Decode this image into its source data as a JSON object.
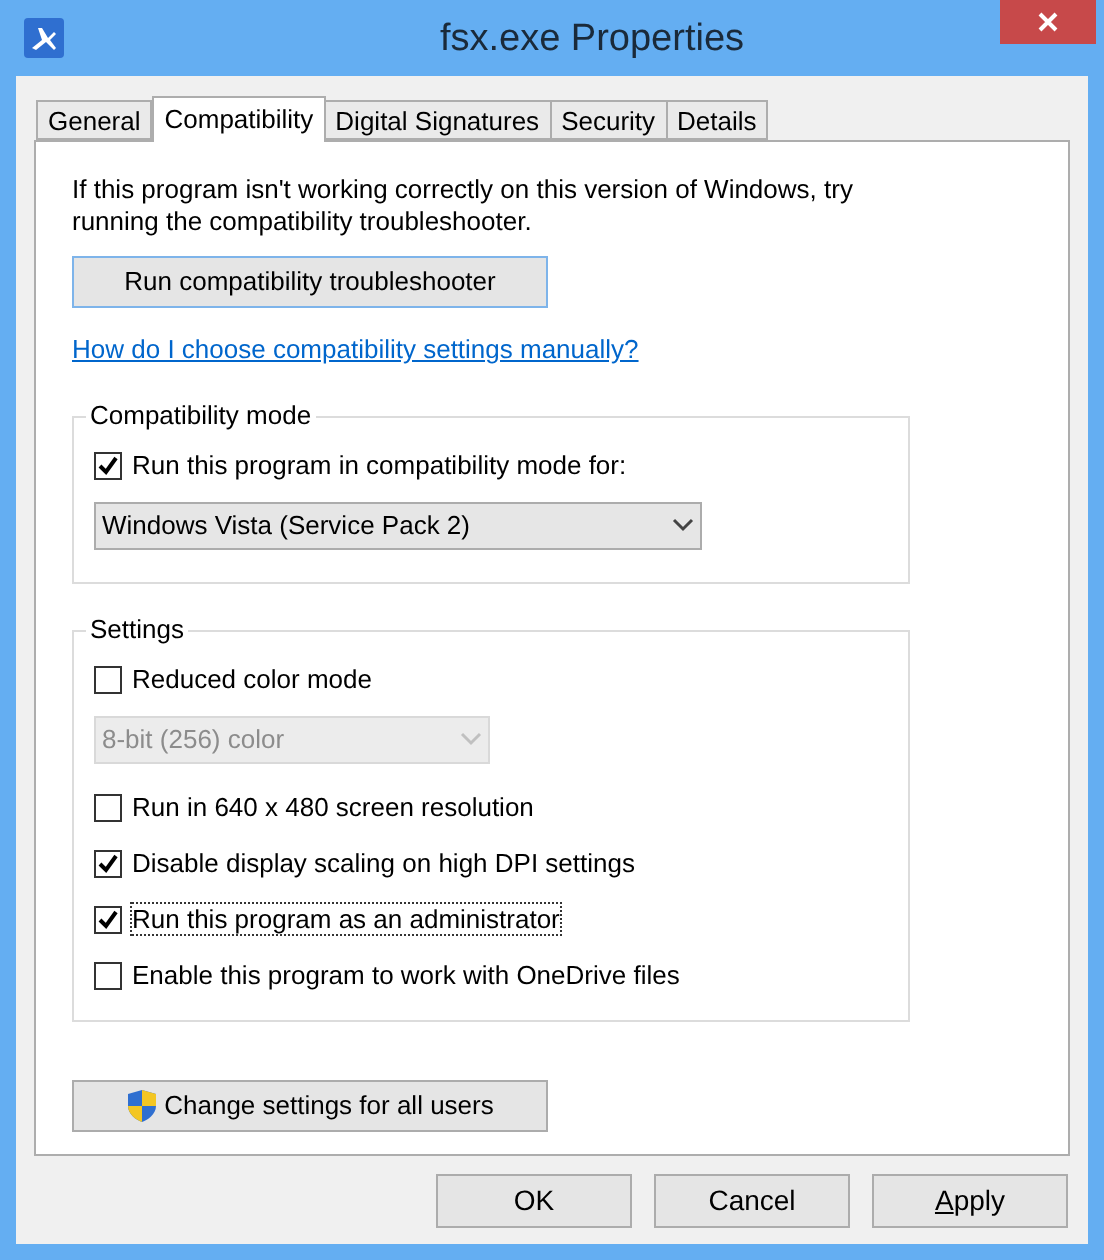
{
  "window": {
    "title": "fsx.exe Properties"
  },
  "tabs": [
    {
      "label": "General",
      "selected": false
    },
    {
      "label": "Compatibility",
      "selected": true
    },
    {
      "label": "Digital Signatures",
      "selected": false
    },
    {
      "label": "Security",
      "selected": false
    },
    {
      "label": "Details",
      "selected": false
    }
  ],
  "intro": "If this program isn't working correctly on this version of Windows, try running the compatibility troubleshooter.",
  "troubleshooter_button": "Run compatibility troubleshooter",
  "help_link": "How do I choose compatibility settings manually?",
  "compatibility_mode": {
    "title": "Compatibility mode",
    "checkbox": {
      "label": "Run this program in compatibility mode for:",
      "checked": true
    },
    "dropdown": {
      "value": "Windows Vista (Service Pack 2)",
      "disabled": false
    }
  },
  "settings": {
    "title": "Settings",
    "items": [
      {
        "kind": "checkbox",
        "label": "Reduced color mode",
        "checked": false,
        "focused": false
      },
      {
        "kind": "dropdown",
        "value": "8-bit (256) color",
        "disabled": true
      },
      {
        "kind": "checkbox",
        "label": "Run in 640 x 480 screen resolution",
        "checked": false,
        "focused": false
      },
      {
        "kind": "checkbox",
        "label": "Disable display scaling on high DPI settings",
        "checked": true,
        "focused": false
      },
      {
        "kind": "checkbox",
        "label": "Run this program as an administrator",
        "checked": true,
        "focused": true
      },
      {
        "kind": "checkbox",
        "label": "Enable this program to work with OneDrive files",
        "checked": false,
        "focused": false
      }
    ]
  },
  "all_users_button": "Change settings for all users",
  "buttons": [
    {
      "label": "OK",
      "first_letter_underlined": false
    },
    {
      "label": "Cancel",
      "first_letter_underlined": false
    },
    {
      "label": "Apply",
      "first_letter_underlined": true
    }
  ]
}
